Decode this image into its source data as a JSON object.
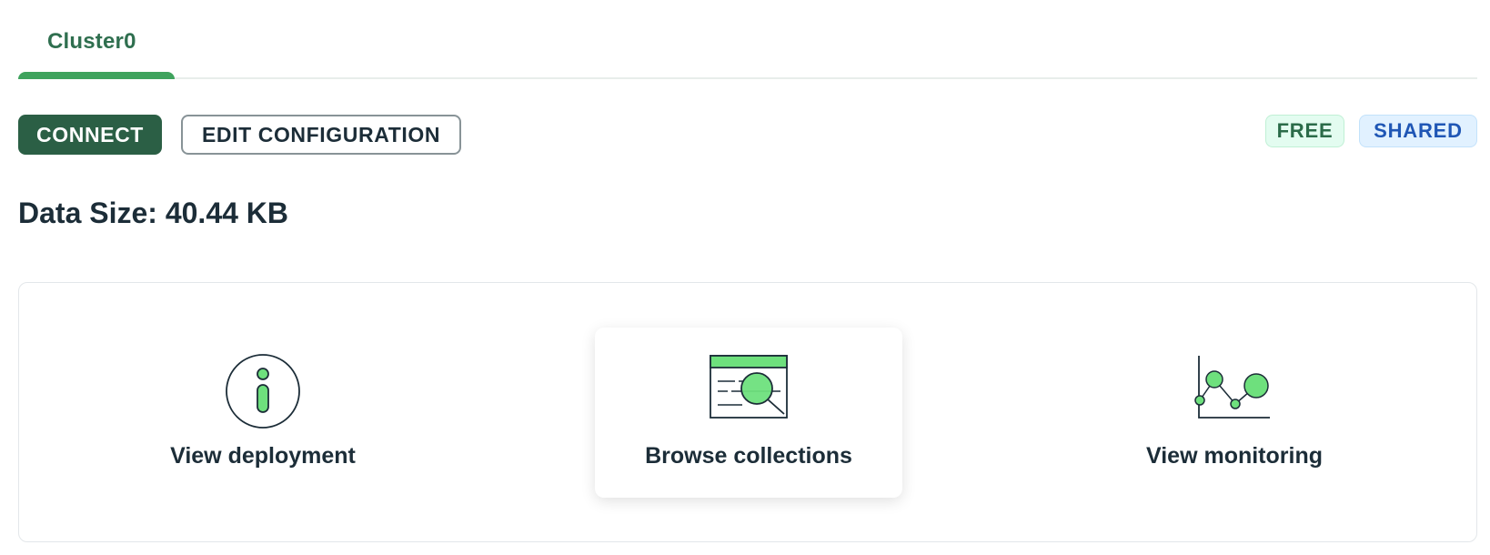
{
  "tabs": [
    {
      "label": "Cluster0",
      "active": true
    }
  ],
  "buttons": {
    "connect": "CONNECT",
    "edit_configuration": "EDIT CONFIGURATION"
  },
  "badges": {
    "free": "FREE",
    "shared": "SHARED"
  },
  "data_size": "Data Size: 40.44 KB",
  "actions": [
    {
      "label": "View deployment",
      "icon": "info-icon"
    },
    {
      "label": "Browse collections",
      "icon": "browse-collections-icon"
    },
    {
      "label": "View monitoring",
      "icon": "monitoring-chart-icon"
    }
  ],
  "colors": {
    "brand_dark_green": "#2b5f45",
    "tab_accent": "#3fa35d",
    "icon_green": "#6ee07d",
    "free_badge_text": "#2b6b49",
    "shared_badge_text": "#1f56b5"
  }
}
